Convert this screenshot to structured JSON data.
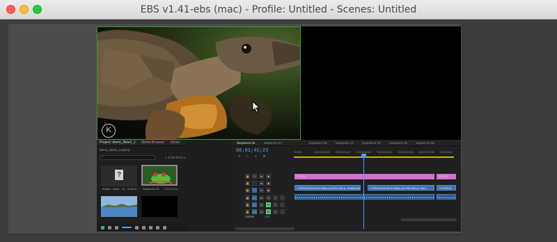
{
  "window": {
    "title": "EBS v1.41-ebs (mac) - Profile: Untitled - Scenes: Untitled"
  },
  "source": {
    "logo": "K"
  },
  "project_panel": {
    "tabs": [
      "Project: demo_New1_1",
      "Media Browser",
      "Librari"
    ],
    "file": "demo_New1_1.prproj",
    "search_placeholder": "⌕",
    "count": "1 of 86 items s...",
    "items": [
      {
        "name": "Adobe - Hello - Yo...",
        "duration": "4:06:12"
      },
      {
        "name": "Sequence 04",
        "duration": "1:24:12:14"
      },
      {
        "name": "",
        "duration": ""
      },
      {
        "name": "",
        "duration": ""
      }
    ]
  },
  "timeline": {
    "tabs": [
      "Sequence 04",
      "Sequence 07",
      "Sequence 06",
      "Sequence 12",
      "Sequence 09",
      "Sequence 05",
      "Sequence 08"
    ],
    "timecode": "00;01;41;23",
    "ruler": [
      ":00;00",
      "00;00;32;00",
      "00;01;04;02",
      "00;01;36;02",
      "00;02;08;04",
      "00;02;40;04",
      "00;03;12;06",
      "00;03;44;1"
    ],
    "tracks": {
      "v2": "V2",
      "v1": "V1",
      "a1": "A1",
      "a2": "A2",
      "a3": "A3",
      "master": "Master",
      "master_value": "0.0"
    },
    "clips": {
      "pink1": "TPO 01",
      "pink2": "TPO 01",
      "video1": "COSTA RICA IN 4K 60fps (ULTRA HD) w- Healthy Birds",
      "video2": "COSTA RICA IN 4K 60fps (ULTRA HD) w- Ham",
      "video3": "COSTA RI"
    }
  }
}
